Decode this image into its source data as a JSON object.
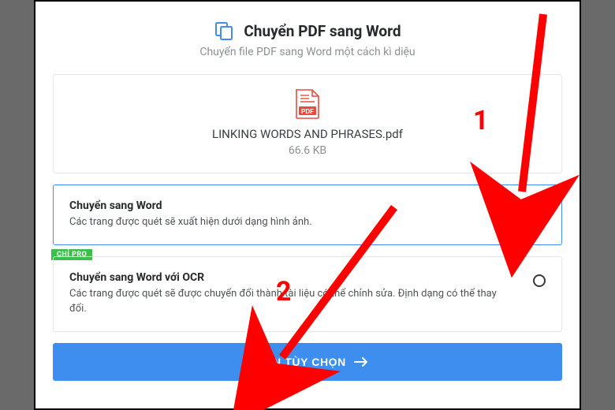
{
  "header": {
    "title": "Chuyển PDF sang Word",
    "subtitle": "Chuyển file PDF sang Word một cách kì diệu"
  },
  "file": {
    "name": "LINKING WORDS AND PHRASES.pdf",
    "size": "66.6 KB",
    "badge": "PDF"
  },
  "options": [
    {
      "title": "Chuyển sang Word",
      "desc": "Các trang được quét sẽ xuất hiện dưới dạng hình ảnh.",
      "selected": true,
      "pro": false
    },
    {
      "title": "Chuyển sang Word với OCR",
      "desc": "Các trang được quét sẽ được chuyển đổi thành tài liệu có thể chỉnh sửa. Định dạng có thể thay đổi.",
      "selected": false,
      "pro": true
    }
  ],
  "pro_label": "CHỈ PRO",
  "action_button": "CHỌN TÙY CHỌN",
  "annotations": {
    "n1": "1",
    "n2": "2"
  },
  "colors": {
    "accent": "#3e8ef0",
    "icon_red": "#e74c3c",
    "pro_green": "#3bbf4b",
    "anno_red": "#ff0000"
  }
}
